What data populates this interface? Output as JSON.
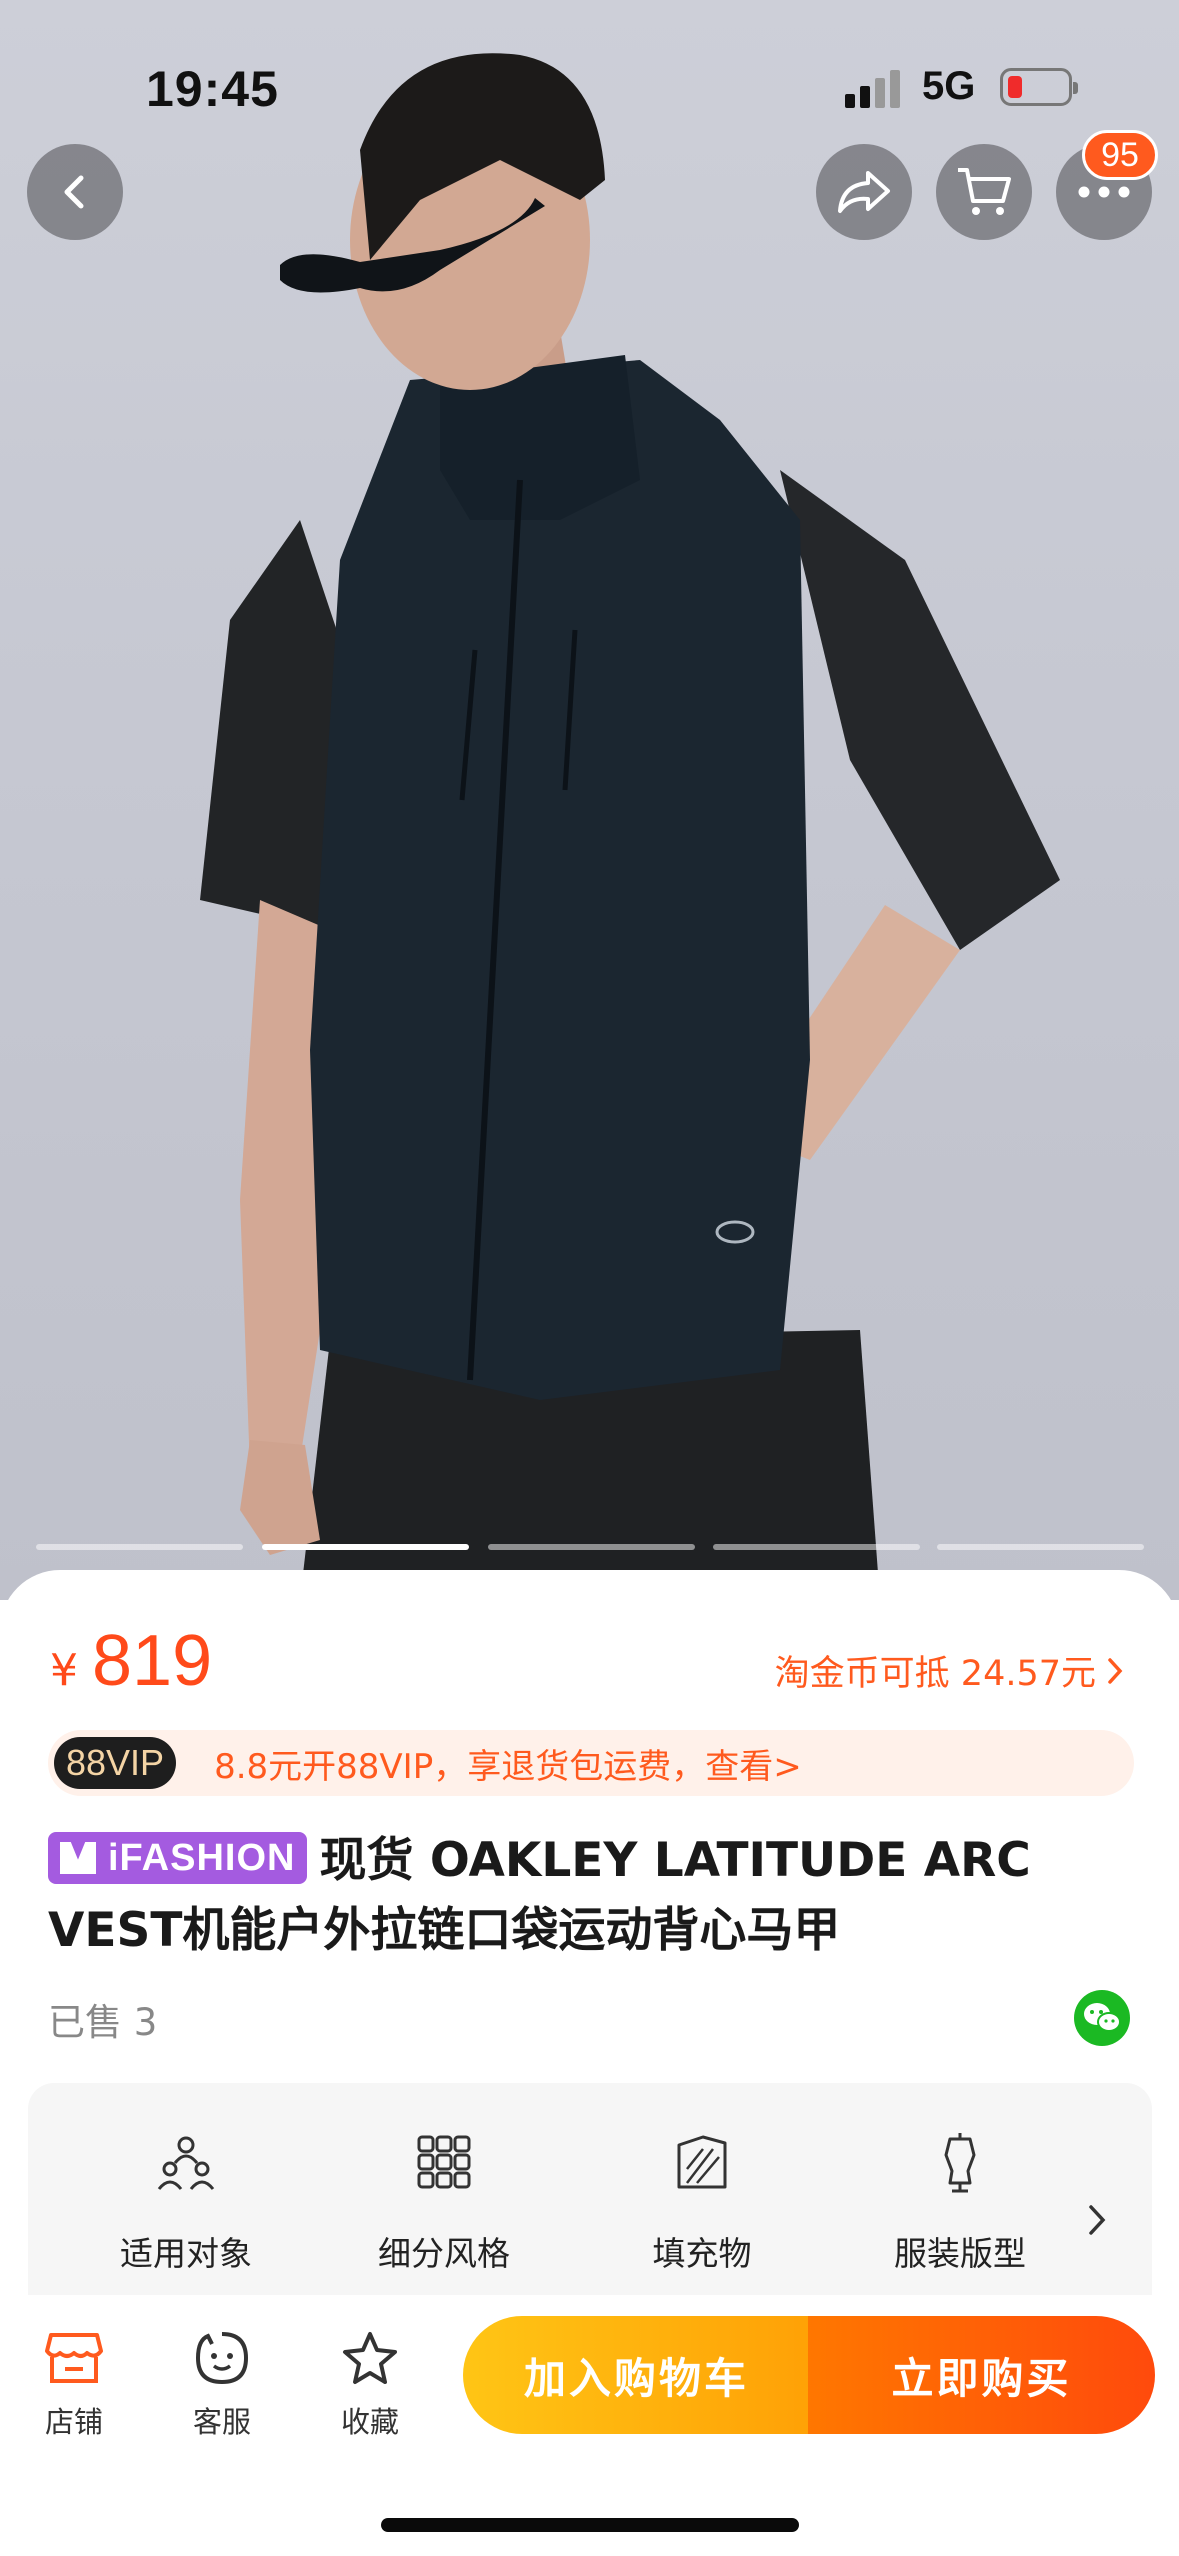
{
  "status_bar": {
    "time": "19:45",
    "network": "5G"
  },
  "top_actions": {
    "more_badge": "95"
  },
  "gallery": {
    "active_index": 1,
    "count": 5
  },
  "price": {
    "currency": "¥",
    "value": "819"
  },
  "coin_offer": "淘金币可抵 24.57元",
  "vip": {
    "badge": "88VIP",
    "text": "8.8元开88VIP，享退货包运费，查看>"
  },
  "product": {
    "tag": "iFASHION",
    "title": "现货 OAKLEY LATITUDE ARC VEST机能户外拉链口袋运动背心马甲",
    "sold": "已售 3"
  },
  "attributes": [
    {
      "label": "适用对象",
      "icon": "people-icon"
    },
    {
      "label": "细分风格",
      "icon": "grid-style-icon"
    },
    {
      "label": "填充物",
      "icon": "jacket-icon"
    },
    {
      "label": "服装版型",
      "icon": "mannequin-icon"
    }
  ],
  "bottom_nav": {
    "store": "店铺",
    "service": "客服",
    "favorite": "收藏"
  },
  "actions": {
    "add_to_cart": "加入购物车",
    "buy_now": "立即购买"
  },
  "colors": {
    "accent": "#ff4a1a",
    "cart_button": "#ffb10d",
    "buy_button": "#ff5a08",
    "tag": "#a45be0"
  }
}
